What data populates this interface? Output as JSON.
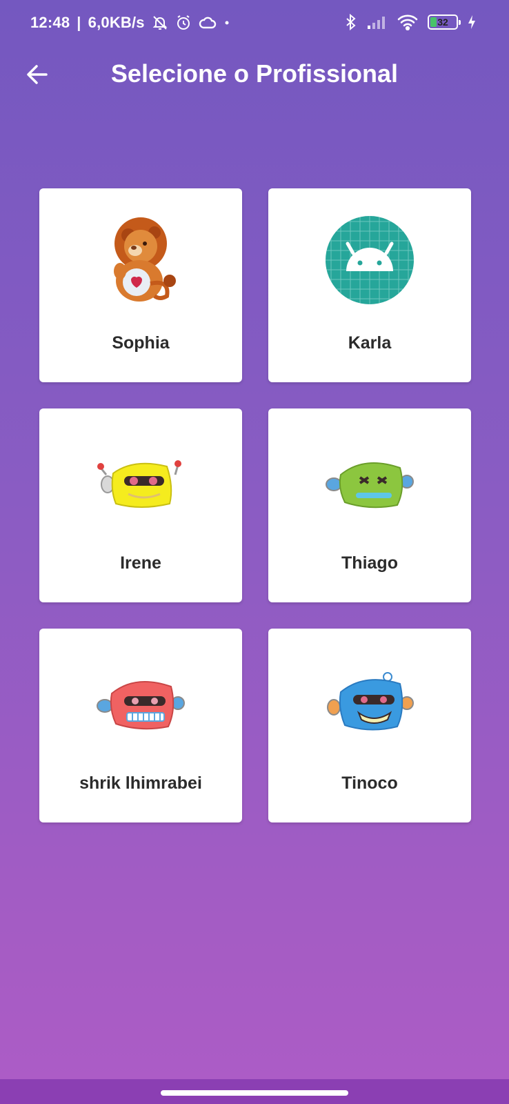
{
  "status_bar": {
    "time": "12:48",
    "separator": "|",
    "network_speed": "6,0KB/s",
    "battery_level": 32,
    "battery_label": "32",
    "icons_left": [
      "mute-bell-icon",
      "alarm-icon",
      "cloud-icon",
      "dot-icon"
    ],
    "icons_right": [
      "bluetooth-icon",
      "signal-icon",
      "wifi-icon",
      "battery-icon",
      "charging-icon"
    ]
  },
  "app_bar": {
    "title": "Selecione o Profissional",
    "back_icon": "arrow-left-icon"
  },
  "professionals": [
    {
      "name": "Sophia",
      "avatar": "lion-bear-avatar"
    },
    {
      "name": "Karla",
      "avatar": "android-avatar"
    },
    {
      "name": "Irene",
      "avatar": "yellow-robot-avatar"
    },
    {
      "name": "Thiago",
      "avatar": "green-robot-avatar"
    },
    {
      "name": "shrik lhimrabei",
      "avatar": "red-robot-avatar"
    },
    {
      "name": "Tinoco",
      "avatar": "blue-robot-avatar"
    }
  ],
  "colors": {
    "background_top": "#7458c0",
    "background_bottom": "#ad5cc6",
    "card": "#ffffff",
    "name_text": "#2b2b2b",
    "nav_bar": "#8b3fb3",
    "android_teal": "#3ddc84",
    "battery_fill": "#49c26a"
  }
}
